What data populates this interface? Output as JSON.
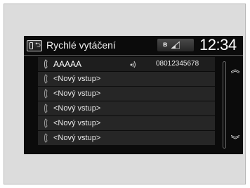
{
  "header": {
    "icon": "phone-menu-icon",
    "title": "Rychlé vytáčení",
    "bluetooth_label": "ʙ",
    "time": "12:34"
  },
  "speed_dial": [
    {
      "name": "AAAAA",
      "number": "08012345678",
      "voice_tag": true
    },
    {
      "name": "<Nový vstup>",
      "number": "",
      "voice_tag": false
    },
    {
      "name": "<Nový vstup>",
      "number": "",
      "voice_tag": false
    },
    {
      "name": "<Nový vstup>",
      "number": "",
      "voice_tag": false
    },
    {
      "name": "<Nový vstup>",
      "number": "",
      "voice_tag": false
    },
    {
      "name": "<Nový vstup>",
      "number": "",
      "voice_tag": false
    }
  ],
  "scroll": {
    "up_icon": "double-chevron-up-icon",
    "down_icon": "double-chevron-down-icon"
  }
}
